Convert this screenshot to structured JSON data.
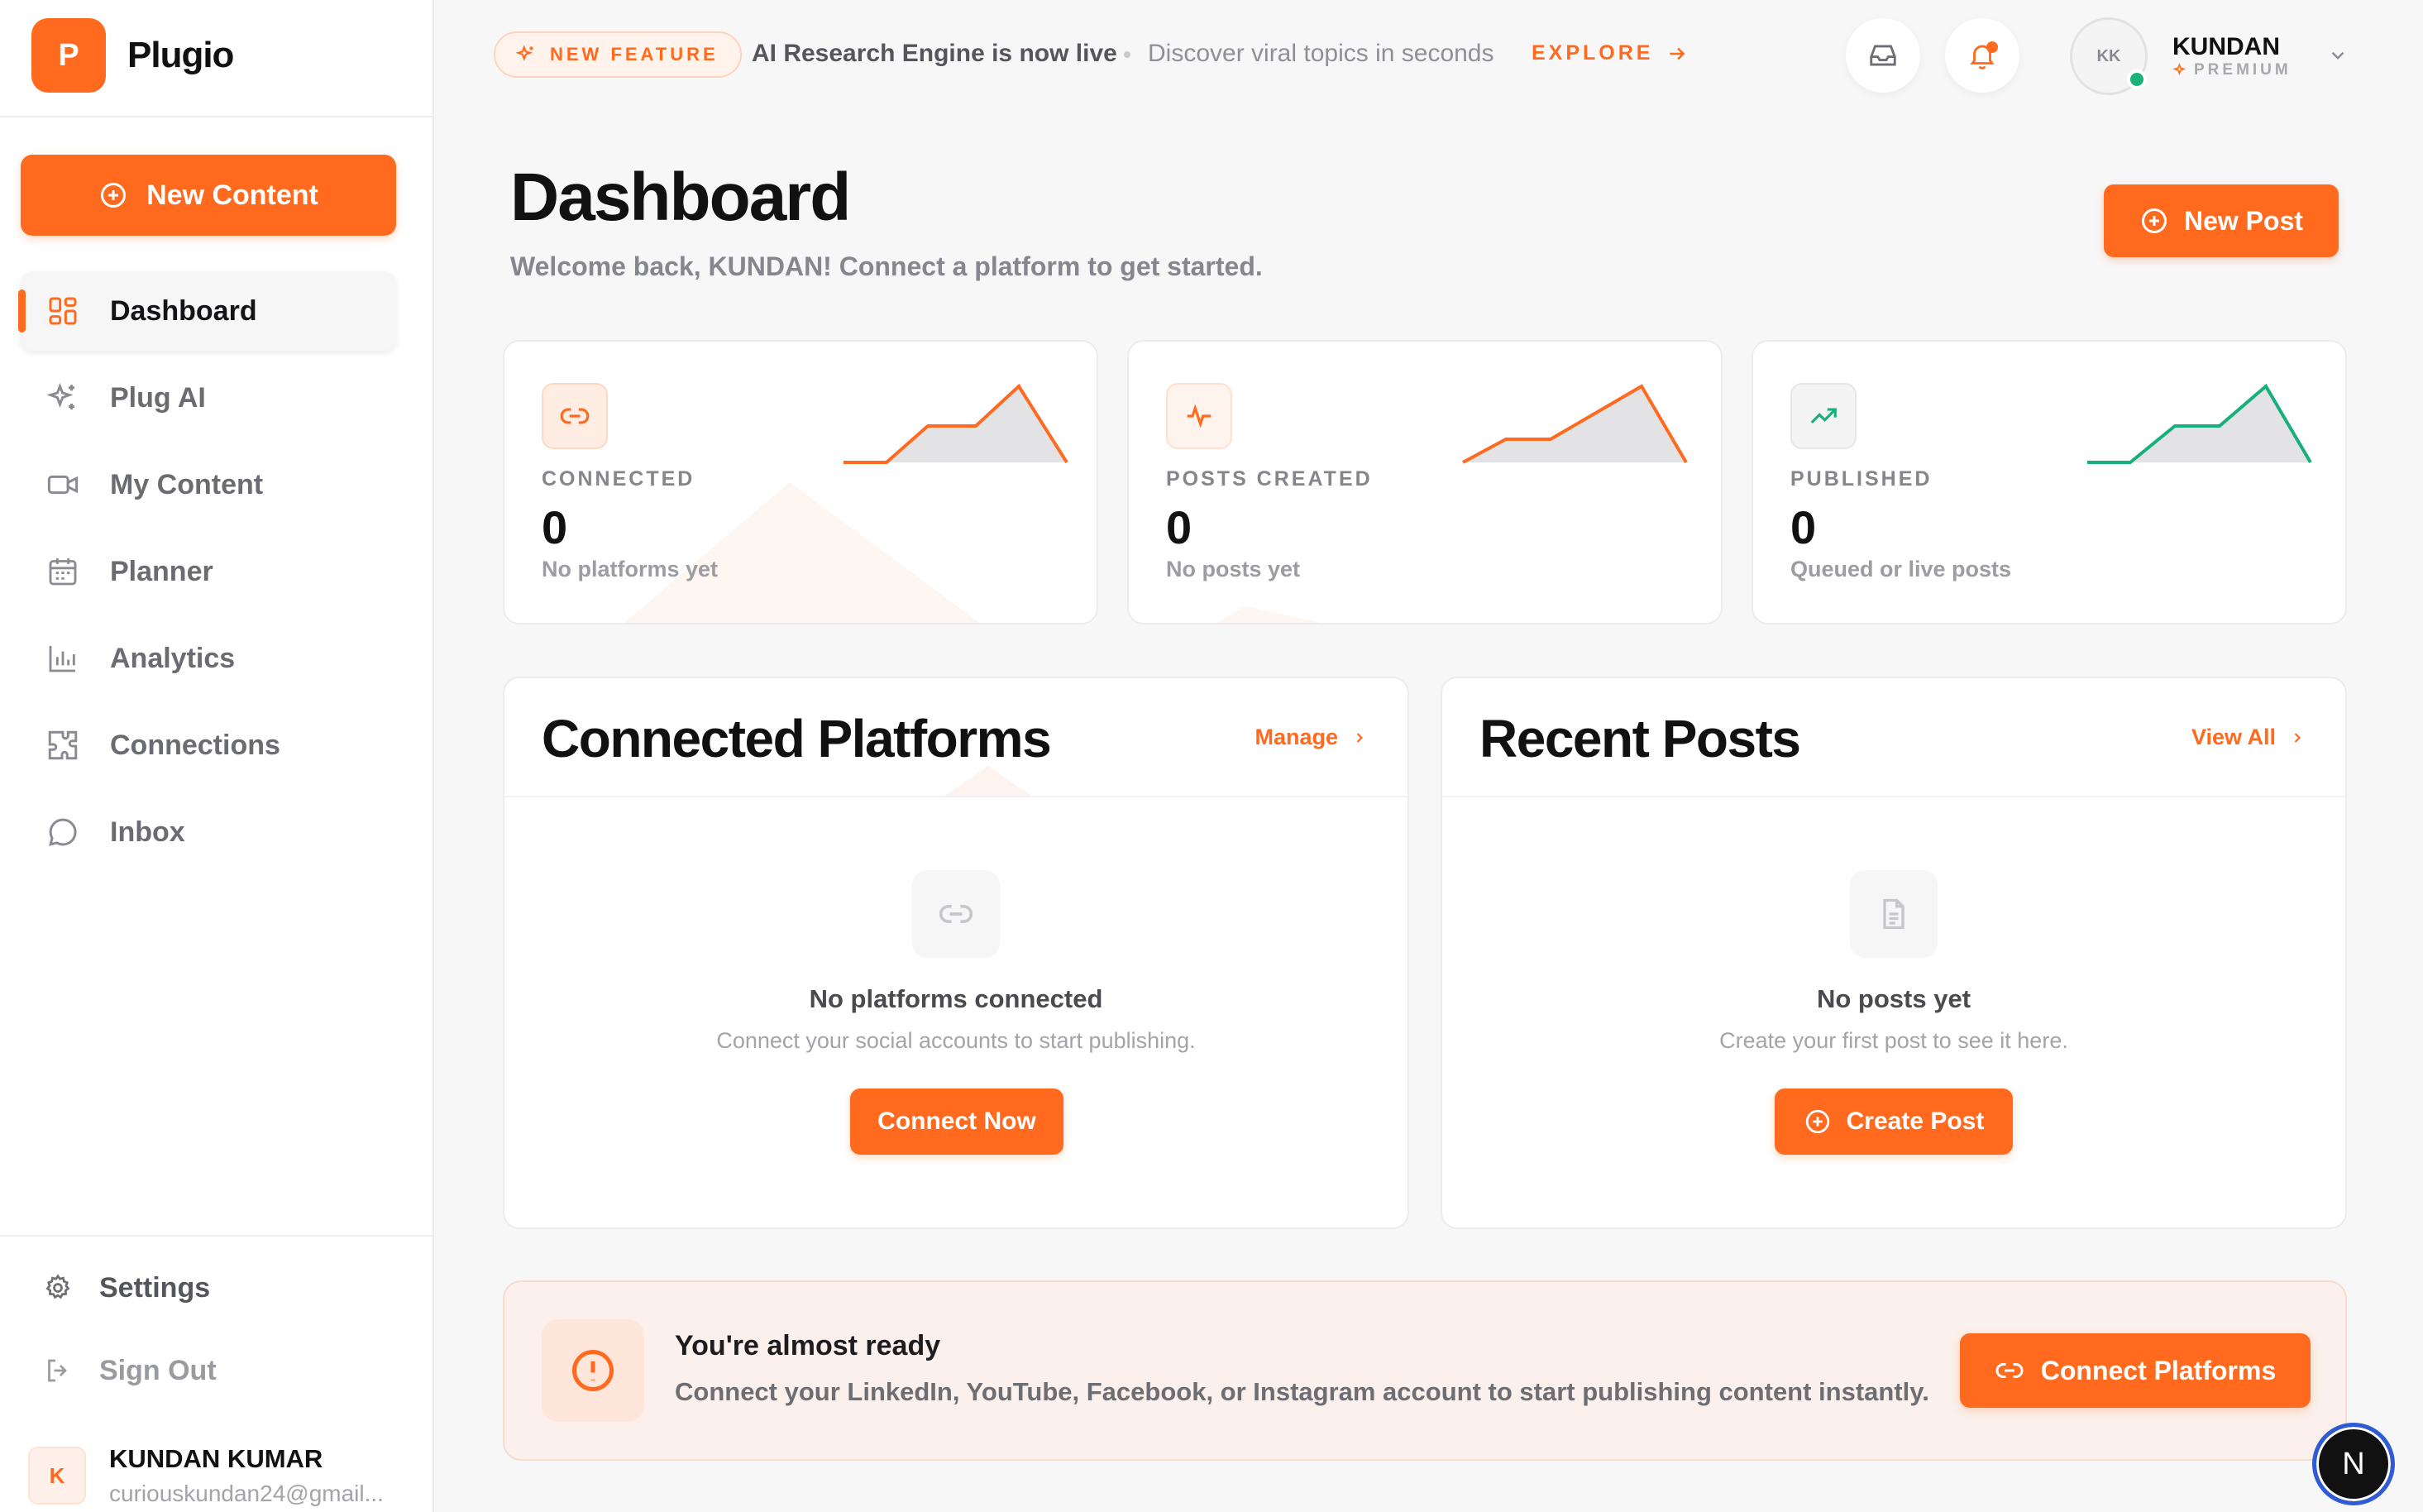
{
  "brand": {
    "logo_letter": "P",
    "name": "Plugio",
    "accent": "#ff6a1f"
  },
  "sidebar": {
    "new_content_label": "New Content",
    "items": [
      {
        "label": "Dashboard",
        "icon": "grid-icon",
        "active": true
      },
      {
        "label": "Plug AI",
        "icon": "sparkles-icon",
        "active": false
      },
      {
        "label": "My Content",
        "icon": "video-icon",
        "active": false
      },
      {
        "label": "Planner",
        "icon": "calendar-icon",
        "active": false
      },
      {
        "label": "Analytics",
        "icon": "bar-chart-icon",
        "active": false
      },
      {
        "label": "Connections",
        "icon": "puzzle-icon",
        "active": false
      },
      {
        "label": "Inbox",
        "icon": "chat-bubble-icon",
        "active": false
      }
    ],
    "settings_label": "Settings",
    "signout_label": "Sign Out",
    "user": {
      "initial": "K",
      "name": "KUNDAN KUMAR",
      "email": "curiouskundan24@gmail..."
    }
  },
  "topbar": {
    "feature_badge": "NEW FEATURE",
    "feature_title": "AI Research Engine is now live",
    "feature_subtitle": "Discover viral topics in seconds",
    "explore_label": "EXPLORE",
    "profile": {
      "initials": "KK",
      "name": "KUNDAN",
      "plan": "PREMIUM",
      "online": true
    }
  },
  "page": {
    "title": "Dashboard",
    "subtitle": "Welcome back, KUNDAN! Connect a platform to get started.",
    "new_post_label": "New Post"
  },
  "stats": [
    {
      "label": "CONNECTED",
      "value": "0",
      "note": "No platforms yet",
      "icon": "link-icon",
      "color": "#ff6a1f"
    },
    {
      "label": "POSTS CREATED",
      "value": "0",
      "note": "No posts yet",
      "icon": "activity-icon",
      "color": "#ff6a1f"
    },
    {
      "label": "PUBLISHED",
      "value": "0",
      "note": "Queued or live posts",
      "icon": "trending-up-icon",
      "color": "#17b07c"
    }
  ],
  "platforms_panel": {
    "title": "Connected Platforms",
    "link_label": "Manage",
    "empty_title": "No platforms connected",
    "empty_subtitle": "Connect your social accounts to start publishing.",
    "button_label": "Connect Now"
  },
  "posts_panel": {
    "title": "Recent Posts",
    "link_label": "View All",
    "empty_title": "No posts yet",
    "empty_subtitle": "Create your first post to see it here.",
    "button_label": "Create Post"
  },
  "banner": {
    "title": "You're almost ready",
    "text": "Connect your LinkedIn, YouTube, Facebook, or Instagram account to start publishing content instantly.",
    "button_label": "Connect Platforms"
  },
  "devtools_badge": "N"
}
